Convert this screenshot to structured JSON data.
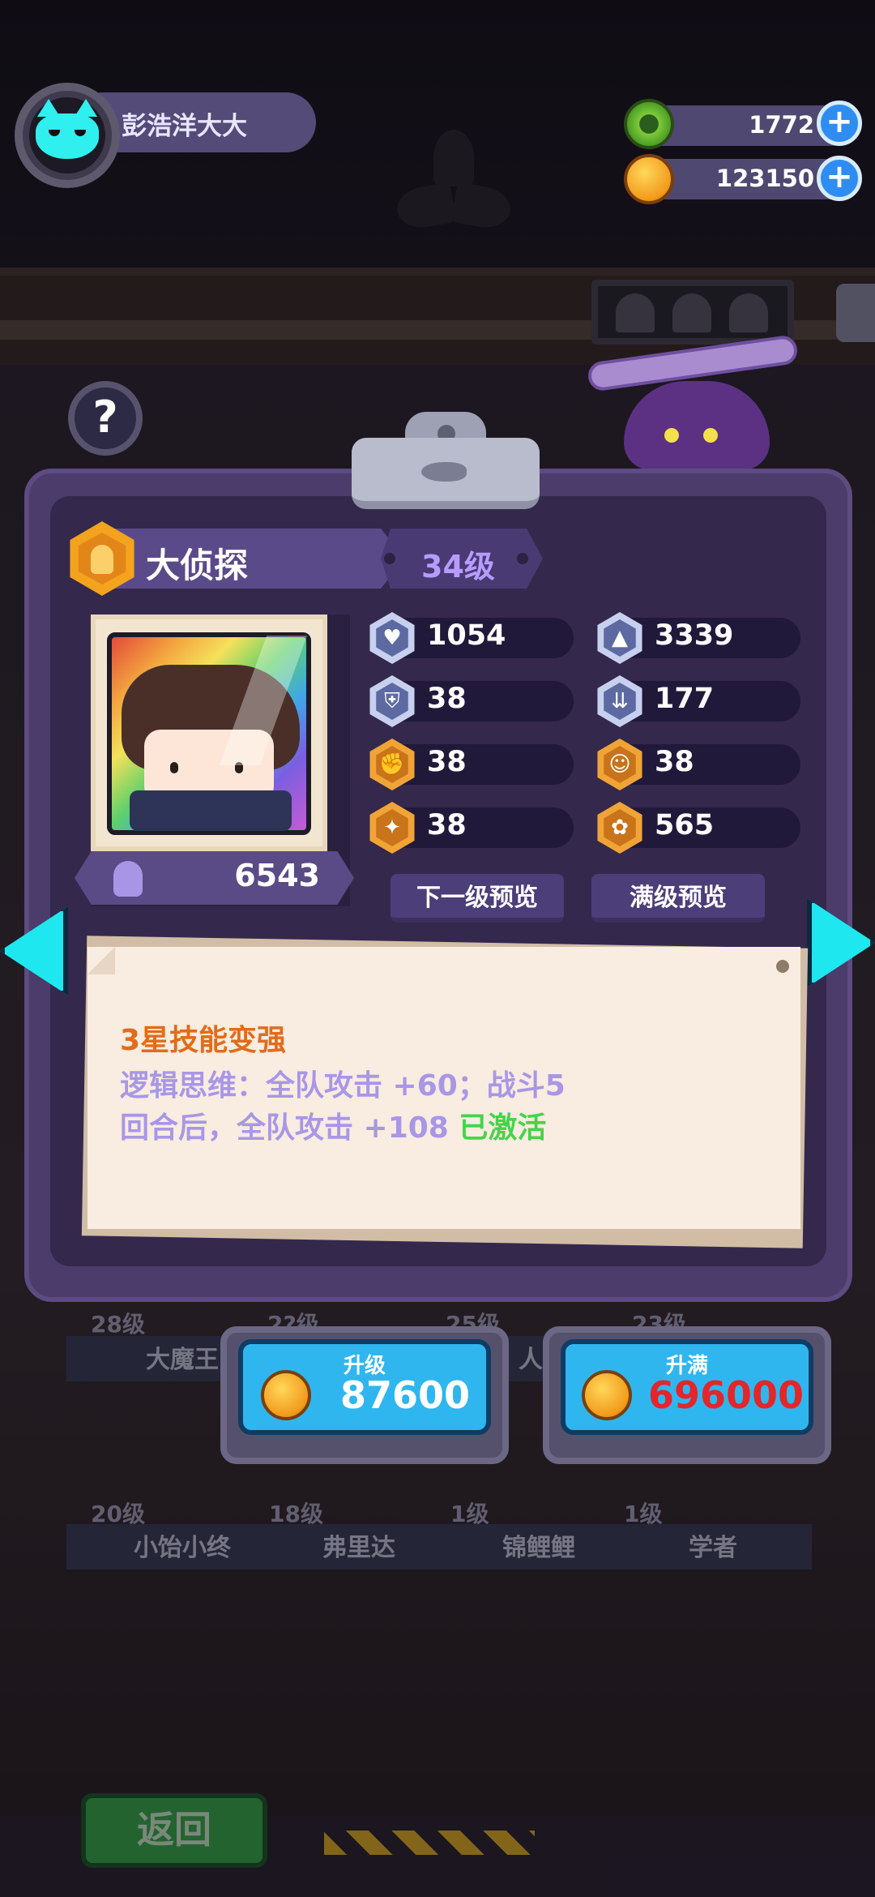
{
  "player": {
    "name": "彭浩洋大大"
  },
  "resources": [
    {
      "name": "gem",
      "icon": "green-gem-icon",
      "value": "1772"
    },
    {
      "name": "coin",
      "icon": "gold-coin-icon",
      "value": "123150"
    }
  ],
  "help": {
    "label": "?"
  },
  "character": {
    "name": "大侦探",
    "level": "34级",
    "power": "6543",
    "stats": [
      {
        "icon": "heart-icon",
        "value": "1054"
      },
      {
        "icon": "attack-icon",
        "value": "3339"
      },
      {
        "icon": "shield-icon",
        "value": "38"
      },
      {
        "icon": "speed-icon",
        "value": "177"
      },
      {
        "icon": "strength-icon",
        "value": "38"
      },
      {
        "icon": "charm-icon",
        "value": "38"
      },
      {
        "icon": "muscle-icon",
        "value": "38"
      },
      {
        "icon": "brain-icon",
        "value": "565"
      }
    ]
  },
  "buttons": {
    "next_level_preview": "下一级预览",
    "max_level_preview": "满级预览"
  },
  "skill": {
    "title": "3星技能变强",
    "line1": "逻辑思维：全队攻击 +60；战斗5",
    "line2": "回合后，全队攻击 +108",
    "status": "已激活"
  },
  "upgrade": {
    "label": "升级",
    "cost": "87600"
  },
  "upgrade_max": {
    "label": "升满",
    "cost": "696000"
  },
  "roster": {
    "row1": [
      {
        "level": "28级",
        "name": "大魔王"
      },
      {
        "level": "2?级",
        "name": ""
      },
      {
        "level": "25级",
        "name": "人"
      },
      {
        "level": "23级",
        "name": ""
      }
    ],
    "row2": [
      {
        "level": "20级",
        "name": "小饴小终"
      },
      {
        "level": "18级",
        "name": "弗里达"
      },
      {
        "level": "1级",
        "name": "锦鲤鲤"
      },
      {
        "level": "1级",
        "name": "学者"
      }
    ]
  },
  "back": {
    "label": "返回"
  },
  "colors": {
    "panel": "#4b3c6b",
    "accent_cyan": "#2fb6ef",
    "cost_red": "#e3262a",
    "skill_orange": "#e26c1a",
    "skill_purple": "#a897e7",
    "active_green": "#45d44a"
  }
}
